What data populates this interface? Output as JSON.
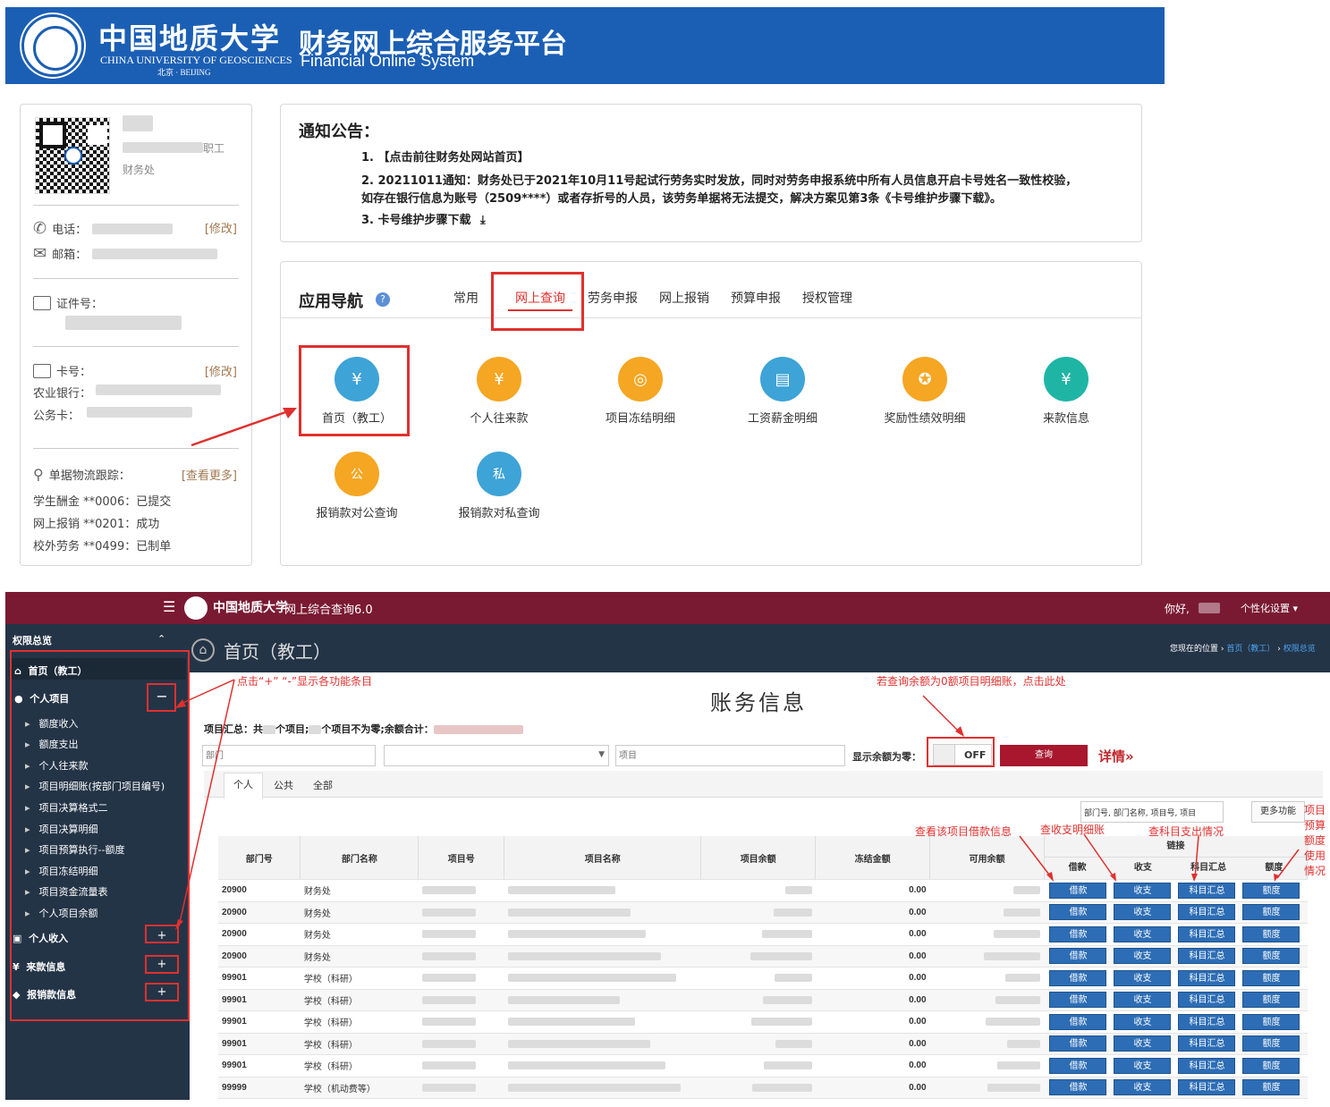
{
  "portal": {
    "logo_cn": "中国地质大学",
    "logo_en": "CHINA UNIVERSITY OF GEOSCIENCES",
    "logo_city": "北京 · BEIJING",
    "system_cn": "财务网上综合服务平台",
    "system_en": "Financial Online System"
  },
  "profile": {
    "role": "职工",
    "dept": "财务处",
    "phone_label": "电话：",
    "email_label": "邮箱：",
    "edit_label": "[修改]",
    "id_label": "证件号：",
    "card_label": "卡号：",
    "bank_label": "农业银行：",
    "public_card_label": "公务卡：",
    "logistics_label": "单据物流跟踪：",
    "more_label": "[查看更多]",
    "logistics": [
      "学生酬金 **0006：已提交",
      "网上报销 **0201：成功",
      "校外劳务 **0499：已制单"
    ]
  },
  "notice": {
    "title": "通知公告：",
    "line1": "1. 【点击前往财务处网站首页】",
    "line2": "2. 20211011通知：财务处已于2021年10月11号起试行劳务实时发放，同时对劳务申报系统中所有人员信息开启卡号姓名一致性校验，",
    "line2b": "如存在银行信息为账号（2509****）或者存折号的人员，该劳务单据将无法提交，解决方案见第3条《卡号维护步骤下载》。",
    "line3": "3. 卡号维护步骤下载"
  },
  "nav": {
    "title": "应用导航",
    "tabs": [
      "常用",
      "网上查询",
      "劳务申报",
      "网上报销",
      "预算申报",
      "授权管理"
    ],
    "apps": [
      {
        "label": "首页（教工）",
        "color": "#3ea3d6",
        "glyph": "¥"
      },
      {
        "label": "个人往来款",
        "color": "#f5a623",
        "glyph": "¥"
      },
      {
        "label": "项目冻结明细",
        "color": "#f5a623",
        "glyph": "◎"
      },
      {
        "label": "工资薪金明细",
        "color": "#3ea3d6",
        "glyph": "▤"
      },
      {
        "label": "奖励性绩效明细",
        "color": "#f5a623",
        "glyph": "✪"
      },
      {
        "label": "来款信息",
        "color": "#1fb5a5",
        "glyph": "¥"
      },
      {
        "label": "报销款对公查询",
        "color": "#f5a623",
        "glyph": "公"
      },
      {
        "label": "报销款对私查询",
        "color": "#3ea3d6",
        "glyph": "私"
      }
    ]
  },
  "query": {
    "menu_icon": "hamburger-icon",
    "logo_text": "中国地质大学",
    "system_title": "网上综合查询6.0",
    "greeting": "你好,",
    "settings": "个性化设置",
    "sidebar_title": "权限总览",
    "page_title": "首页（教工）",
    "breadcrumb_prefix": "您现在的位置",
    "breadcrumb_1": "首页（教工）",
    "breadcrumb_2": "权限总览",
    "side_home": "首页（教工）",
    "side_personal": "个人项目",
    "side_subitems": [
      "额度收入",
      "额度支出",
      "个人往来款",
      "项目明细账(按部门项目编号)",
      "项目决算格式二",
      "项目决算明细",
      "项目预算执行--额度",
      "项目冻结明细",
      "项目资金流量表",
      "个人项目余额"
    ],
    "side_income": "个人收入",
    "side_incoming": "来款信息",
    "side_reimb": "报销款信息",
    "content_title": "账务信息",
    "summary": "项目汇总：共",
    "summary_mid1": "个项目;",
    "summary_mid2": "个项目不为零;余额合计：",
    "dept_placeholder": "部门",
    "project_placeholder": "项目",
    "show_zero_label": "显示余额为零：",
    "toggle": "OFF",
    "query_btn": "查询",
    "detail_link": "详情»",
    "tabs": [
      "个人",
      "公共",
      "全部"
    ],
    "column_select": "部门号, 部门名称, 项目号, 项目",
    "more_btn": "更多功能",
    "headers": [
      "部门号",
      "部门名称",
      "项目号",
      "项目名称",
      "项目余额",
      "冻结金额",
      "可用余额"
    ],
    "link_header": "链接",
    "link_cols": [
      "借款",
      "收支",
      "科目汇总",
      "额度"
    ],
    "rows": [
      {
        "dept_no": "20900",
        "dept_name": "财务处",
        "frozen": "0.00"
      },
      {
        "dept_no": "20900",
        "dept_name": "财务处",
        "frozen": "0.00"
      },
      {
        "dept_no": "20900",
        "dept_name": "财务处",
        "frozen": "0.00"
      },
      {
        "dept_no": "20900",
        "dept_name": "财务处",
        "frozen": "0.00"
      },
      {
        "dept_no": "99901",
        "dept_name": "学校（科研）",
        "frozen": "0.00"
      },
      {
        "dept_no": "99901",
        "dept_name": "学校（科研）",
        "frozen": "0.00"
      },
      {
        "dept_no": "99901",
        "dept_name": "学校（科研）",
        "frozen": "0.00"
      },
      {
        "dept_no": "99901",
        "dept_name": "学校（科研）",
        "frozen": "0.00"
      },
      {
        "dept_no": "99901",
        "dept_name": "学校（科研）",
        "frozen": "0.00"
      },
      {
        "dept_no": "99999",
        "dept_name": "学校（机动费等）",
        "frozen": "0.00"
      }
    ]
  },
  "annotations": {
    "expand_hint": "点击“+” “-”显示各功能条目",
    "zero_hint": "若查询余额为0额项目明细账，点击此处",
    "loan_hint": "查看该项目借款信息",
    "income_hint": "查收支明细账",
    "subject_hint": "查科目支出情况",
    "quota_hint": "项目预算额度使用情况"
  }
}
